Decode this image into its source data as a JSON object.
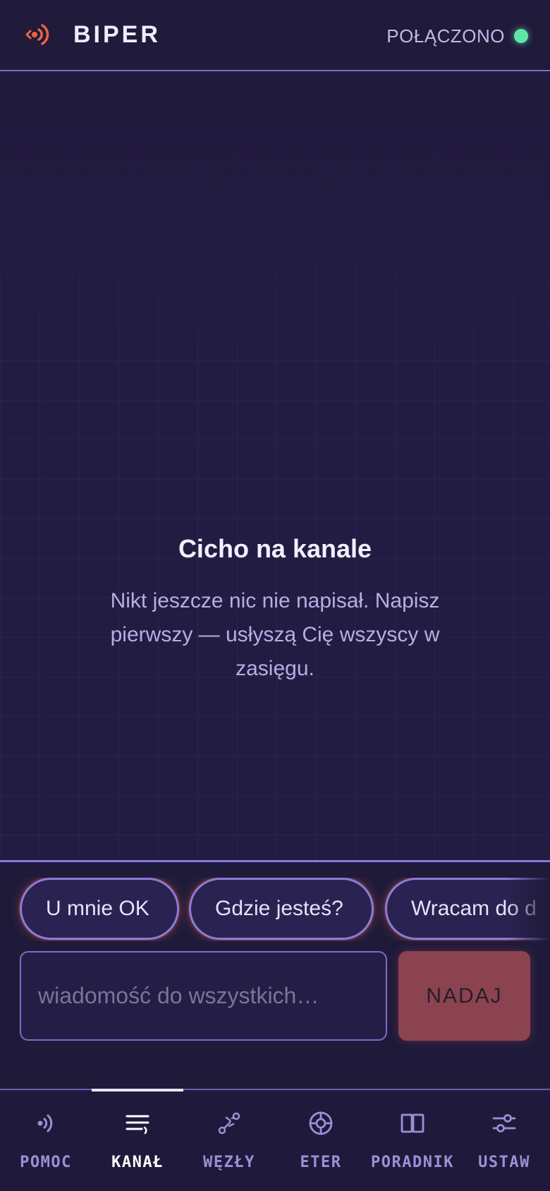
{
  "header": {
    "app_title": "BIPER",
    "status_text": "POŁĄCZONO",
    "status_color": "#5fe6a6",
    "logo_icon": "broadcast-icon",
    "logo_color": "#e8643f"
  },
  "channel": {
    "empty_title": "Cicho na kanale",
    "empty_description": "Nikt jeszcze nic nie napisał. Napisz pierwszy — usłyszą Cię wszyscy w zasięgu."
  },
  "composer": {
    "quick_replies": [
      "U mnie OK",
      "Gdzie jesteś?",
      "Wracam do d"
    ],
    "input_placeholder": "wiadomość do wszystkich…",
    "input_value": "",
    "send_label": "NADAJ"
  },
  "nav": {
    "active_index": 1,
    "items": [
      {
        "label": "POMOC",
        "icon": "signal-icon"
      },
      {
        "label": "KANAŁ",
        "icon": "messages-icon"
      },
      {
        "label": "WĘZŁY",
        "icon": "route-icon"
      },
      {
        "label": "ETER",
        "icon": "target-icon"
      },
      {
        "label": "PORADNIK",
        "icon": "book-icon"
      },
      {
        "label": "USTAW",
        "icon": "sliders-icon"
      }
    ]
  },
  "colors": {
    "accent": "#8a78d6",
    "background": "#221c3f",
    "send_button": "#8b4350"
  }
}
